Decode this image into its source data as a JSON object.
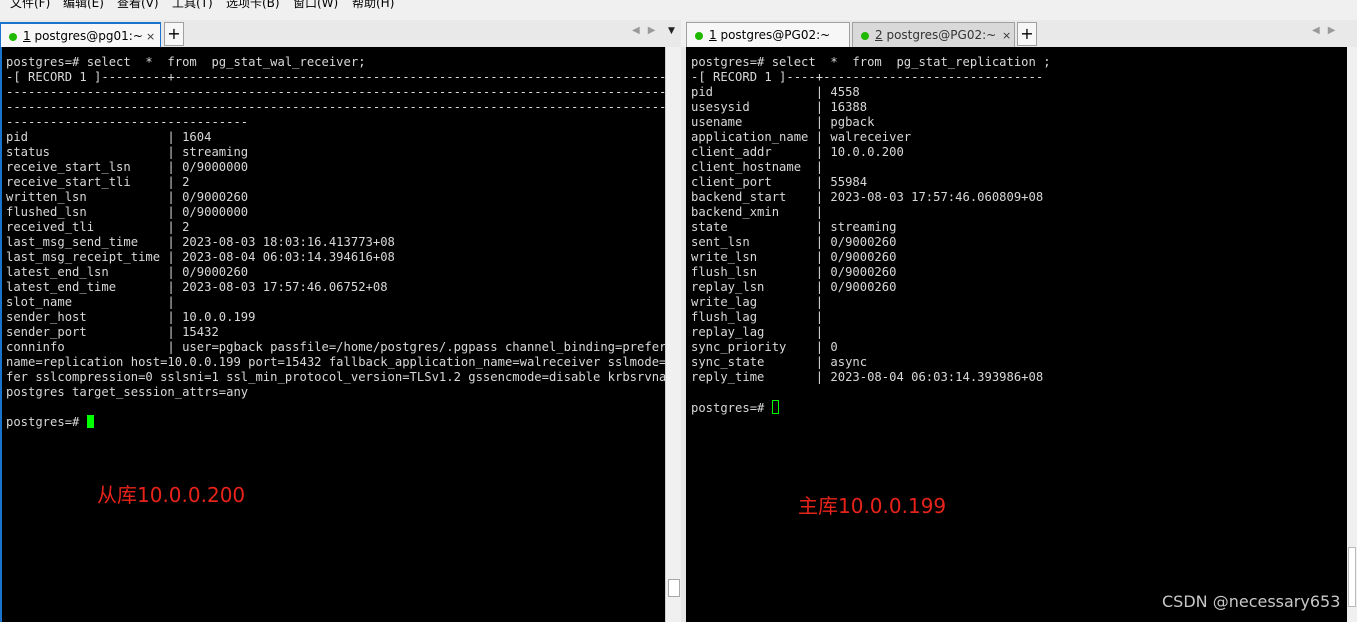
{
  "menu": [
    "文件(F)",
    "编辑(E)",
    "查看(V)",
    "工具(T)",
    "选项卡(B)",
    "窗口(W)",
    "帮助(H)"
  ],
  "left": {
    "tab": {
      "number": "1",
      "label": "postgres@pg01:~"
    },
    "output": "postgres=# select  *  from  pg_stat_wal_receiver;\n-[ RECORD 1 ]---------+---------------------------------------------------------------------------------------------\n---------------------------------------------------------------------------------------------------------\n---------------------------------------------------------------------------------------------------------\n---------------------------------\npid                   | 1604\nstatus                | streaming\nreceive_start_lsn     | 0/9000000\nreceive_start_tli     | 2\nwritten_lsn           | 0/9000260\nflushed_lsn           | 0/9000000\nreceived_tli          | 2\nlast_msg_send_time    | 2023-08-03 18:03:16.413773+08\nlast_msg_receipt_time | 2023-08-04 06:03:14.394616+08\nlatest_end_lsn        | 0/9000260\nlatest_end_time       | 2023-08-03 17:57:46.06752+08\nslot_name             |\nsender_host           | 10.0.0.199\nsender_port           | 15432\nconninfo              | user=pgback passfile=/home/postgres/.pgpass channel_binding=prefer db\nname=replication host=10.0.0.199 port=15432 fallback_application_name=walreceiver sslmode=pre\nfer sslcompression=0 sslsni=1 ssl_min_protocol_version=TLSv1.2 gssencmode=disable krbsrvname=\npostgres target_session_attrs=any\n",
    "prompt": "postgres=# ",
    "annotation": "从库10.0.0.200"
  },
  "right": {
    "tabs": [
      {
        "number": "1",
        "label": "postgres@PG02:~"
      },
      {
        "number": "2",
        "label": "postgres@PG02:~"
      }
    ],
    "output": "postgres=# select  *  from  pg_stat_replication ;\n-[ RECORD 1 ]----+------------------------------\npid              | 4558\nusesysid         | 16388\nusename          | pgback\napplication_name | walreceiver\nclient_addr      | 10.0.0.200\nclient_hostname  |\nclient_port      | 55984\nbackend_start    | 2023-08-03 17:57:46.060809+08\nbackend_xmin     |\nstate            | streaming\nsent_lsn         | 0/9000260\nwrite_lsn        | 0/9000260\nflush_lsn        | 0/9000260\nreplay_lsn       | 0/9000260\nwrite_lag        |\nflush_lag        |\nreplay_lag       |\nsync_priority    | 0\nsync_state       | async\nreply_time       | 2023-08-04 06:03:14.393986+08\n",
    "prompt": "postgres=# ",
    "annotation": "主库10.0.0.199"
  },
  "watermark": "CSDN @necessary653",
  "icons": {
    "close": "×",
    "add": "+",
    "nav": "◀▶",
    "dropdown": "▼"
  }
}
